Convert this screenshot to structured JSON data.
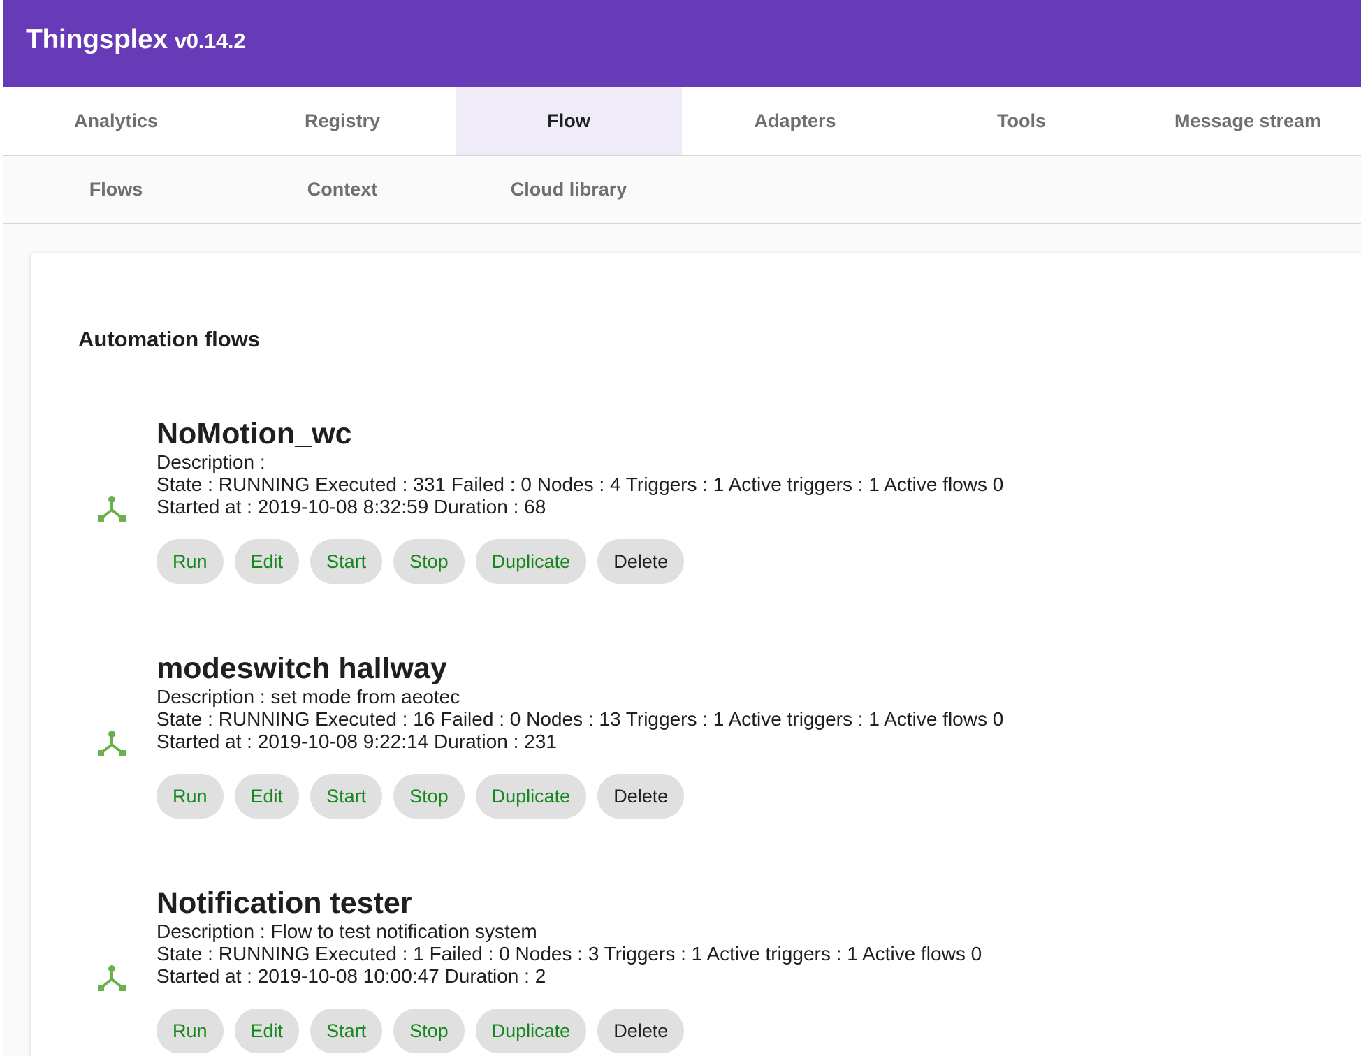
{
  "header": {
    "title": "Thingsplex",
    "version": "v0.14.2"
  },
  "nav": {
    "tabs": [
      {
        "label": "Analytics"
      },
      {
        "label": "Registry"
      },
      {
        "label": "Flow"
      },
      {
        "label": "Adapters"
      },
      {
        "label": "Tools"
      },
      {
        "label": "Message stream"
      }
    ],
    "active_tab": "Flow"
  },
  "subnav": {
    "tabs": [
      {
        "label": "Flows"
      },
      {
        "label": "Context"
      },
      {
        "label": "Cloud library"
      }
    ]
  },
  "main": {
    "title": "Automation flows",
    "flows": [
      {
        "icon": "flow-icon",
        "name": "NoMotion_wc",
        "description": "Description :",
        "state": "State : RUNNING Executed : 331 Failed : 0 Nodes : 4 Triggers : 1 Active triggers : 1 Active flows 0",
        "started": "Started at : 2019-10-08 8:32:59 Duration : 68",
        "buttons": {
          "run": "Run",
          "edit": "Edit",
          "start": "Start",
          "stop": "Stop",
          "duplicate": "Duplicate",
          "delete": "Delete"
        }
      },
      {
        "icon": "flow-icon",
        "name": "modeswitch hallway",
        "description": "Description : set mode from aeotec",
        "state": "State : RUNNING Executed : 16 Failed : 0 Nodes : 13 Triggers : 1 Active triggers : 1 Active flows 0",
        "started": "Started at : 2019-10-08 9:22:14 Duration : 231",
        "buttons": {
          "run": "Run",
          "edit": "Edit",
          "start": "Start",
          "stop": "Stop",
          "duplicate": "Duplicate",
          "delete": "Delete"
        }
      },
      {
        "icon": "flow-icon",
        "name": "Notification tester",
        "description": "Description : Flow to test notification system",
        "state": "State : RUNNING Executed : 1 Failed : 0 Nodes : 3 Triggers : 1 Active triggers : 1 Active flows 0",
        "started": "Started at : 2019-10-08 10:00:47 Duration : 2",
        "buttons": {
          "run": "Run",
          "edit": "Edit",
          "start": "Start",
          "stop": "Stop",
          "duplicate": "Duplicate",
          "delete": "Delete"
        }
      }
    ]
  },
  "colors": {
    "header": "#673ab7",
    "active_tab": "#efebf7",
    "icon_green": "#6ab04c",
    "button_text_green": "#15871d",
    "button_bg": "#e0e0e0"
  }
}
